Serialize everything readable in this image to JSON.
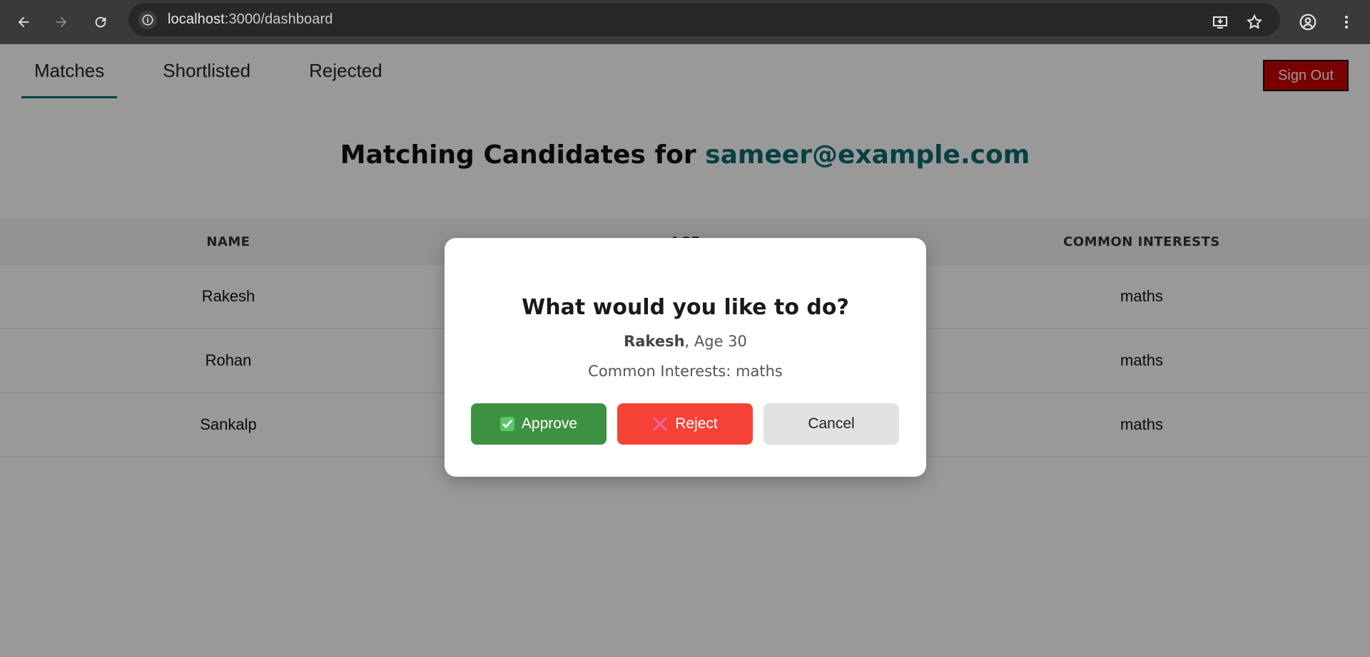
{
  "browser": {
    "url_host": "localhost",
    "url_path": ":3000/dashboard",
    "icons": [
      "back-arrow-icon",
      "forward-arrow-icon",
      "reload-icon",
      "site-info-icon",
      "install-app-icon",
      "star-icon",
      "profile-icon",
      "menu-dots-icon"
    ]
  },
  "nav": {
    "tabs": [
      {
        "label": "Matches",
        "active": true
      },
      {
        "label": "Shortlisted",
        "active": false
      },
      {
        "label": "Rejected",
        "active": false
      }
    ],
    "sign_out": "Sign Out"
  },
  "page": {
    "heading_prefix": "Matching Candidates for ",
    "heading_email": "sameer@example.com"
  },
  "table": {
    "headers": [
      "NAME",
      "AGE",
      "COMMON INTERESTS"
    ],
    "rows": [
      {
        "name": "Rakesh",
        "age": "30",
        "interests": "maths"
      },
      {
        "name": "Rohan",
        "age": "",
        "interests": "maths"
      },
      {
        "name": "Sankalp",
        "age": "",
        "interests": "maths"
      }
    ]
  },
  "modal": {
    "title": "What would you like to do?",
    "candidate_name": "Rakesh",
    "age_text": ", Age 30",
    "interests_text": "Common Interests: maths",
    "approve": "Approve",
    "reject": "Reject",
    "cancel": "Cancel"
  },
  "colors": {
    "accent": "#0b6b6b",
    "approve": "#3d9140",
    "reject": "#f44336",
    "sign_out": "#cc0000"
  }
}
